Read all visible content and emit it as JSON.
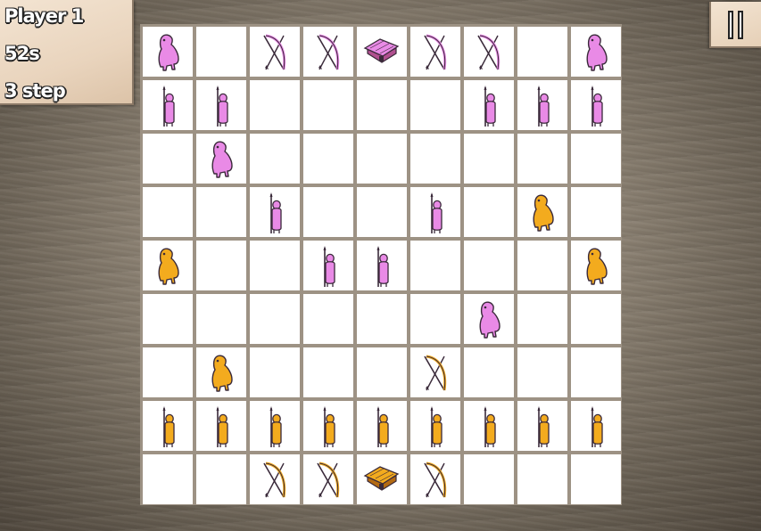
{
  "hud": {
    "player_label": "Player 1",
    "timer": "52s",
    "steps": "3 step"
  },
  "pause_button": {
    "icon": "pause-icon"
  },
  "colors": {
    "pink": "#e98ae6",
    "orange": "#f3ab1e"
  },
  "board": {
    "rows": [
      [
        "p-beast",
        "",
        "p-archer",
        "p-archer",
        "p-house",
        "p-archer",
        "p-archer",
        "",
        "p-beast"
      ],
      [
        "p-spear",
        "p-spear",
        "",
        "",
        "",
        "",
        "p-spear",
        "p-spear",
        "p-spear"
      ],
      [
        "",
        "p-beast",
        "",
        "",
        "",
        "",
        "",
        "",
        ""
      ],
      [
        "",
        "",
        "p-spear",
        "",
        "",
        "p-spear",
        "",
        "o-beast",
        ""
      ],
      [
        "o-beast",
        "",
        "",
        "p-spear",
        "p-spear",
        "",
        "",
        "",
        "o-beast"
      ],
      [
        "",
        "",
        "",
        "",
        "",
        "",
        "p-beast",
        "",
        ""
      ],
      [
        "",
        "o-beast",
        "",
        "",
        "",
        "o-archer",
        "",
        "",
        ""
      ],
      [
        "o-spear",
        "o-spear",
        "o-spear",
        "o-spear",
        "o-spear",
        "o-spear",
        "o-spear",
        "o-spear",
        "o-spear"
      ],
      [
        "",
        "",
        "o-archer",
        "o-archer",
        "o-house",
        "o-archer",
        "",
        "",
        ""
      ]
    ]
  }
}
